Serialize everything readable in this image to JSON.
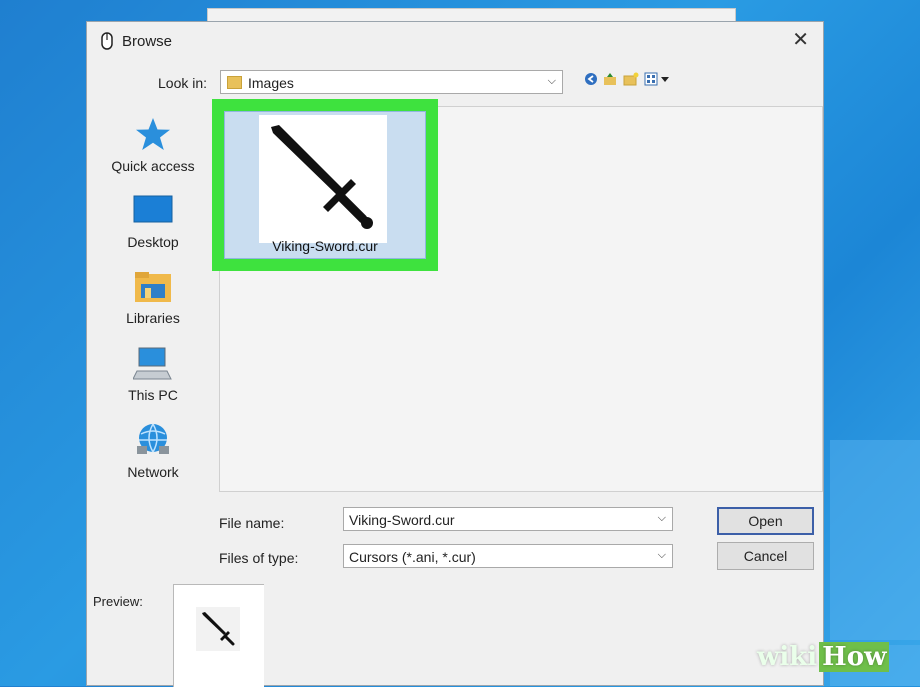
{
  "dialog": {
    "title": "Browse",
    "close_glyph": "✕"
  },
  "lookin": {
    "label": "Look in:",
    "value": "Images",
    "toolbar_icons": [
      "back-icon",
      "up-folder-icon",
      "new-folder-icon",
      "view-menu-icon"
    ]
  },
  "places": [
    {
      "label": "Quick access",
      "icon": "star-icon"
    },
    {
      "label": "Desktop",
      "icon": "desktop-icon"
    },
    {
      "label": "Libraries",
      "icon": "libraries-icon"
    },
    {
      "label": "This PC",
      "icon": "this-pc-icon"
    },
    {
      "label": "Network",
      "icon": "network-icon"
    }
  ],
  "files": [
    {
      "name": "Viking-Sword.cur",
      "selected": true,
      "highlight_color": "#3ee23e"
    }
  ],
  "form": {
    "file_name_label": "File name:",
    "file_name_value": "Viking-Sword.cur",
    "file_type_label": "Files of type:",
    "file_type_value": "Cursors (*.ani, *.cur)",
    "open_label": "Open",
    "cancel_label": "Cancel"
  },
  "preview": {
    "label": "Preview:"
  },
  "watermark": {
    "part1": "wiki",
    "part2": "How"
  },
  "colors": {
    "accent": "#3c5fa8",
    "highlight": "#3ee23e",
    "selection": "#c9ddf0"
  }
}
